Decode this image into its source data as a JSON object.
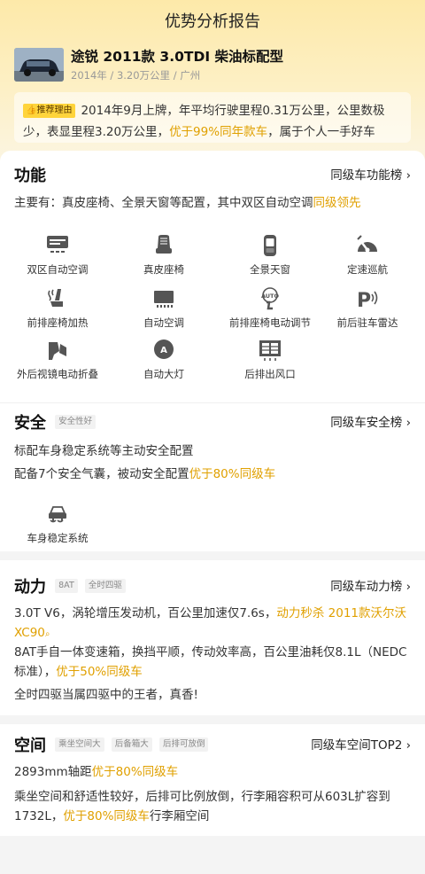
{
  "header": {
    "title": "优势分析报告"
  },
  "car": {
    "title": "途锐 2011款 3.0TDI 柴油标配型",
    "meta": "2014年 / 3.20万公里 / 广州"
  },
  "reason": {
    "badge": "推荐理由",
    "text1": "2014年9月上牌，年平均行驶里程0.31万公里，公里数极少，表显里程3.20万公里，",
    "highlight": "优于99%同年款车",
    "text2": "，属于个人一手好车"
  },
  "features": {
    "title": "功能",
    "more": "同级车功能榜 ›",
    "summary1": "主要有：真皮座椅、全景天窗等配置，其中双区自动空调",
    "summary_hl": "同级领先",
    "items": [
      {
        "label": "双区自动空调",
        "icon": "ac-dual-zone-icon"
      },
      {
        "label": "真皮座椅",
        "icon": "leather-seat-icon"
      },
      {
        "label": "全景天窗",
        "icon": "sunroof-icon"
      },
      {
        "label": "定速巡航",
        "icon": "cruise-control-icon"
      },
      {
        "label": "前排座椅加热",
        "icon": "seat-heating-icon"
      },
      {
        "label": "自动空调",
        "icon": "auto-ac-icon"
      },
      {
        "label": "前排座椅电动调节",
        "icon": "auto-seat-adjust-icon"
      },
      {
        "label": "前后驻车雷达",
        "icon": "parking-radar-icon"
      },
      {
        "label": "外后视镜电动折叠",
        "icon": "mirror-fold-icon"
      },
      {
        "label": "自动大灯",
        "icon": "auto-headlight-icon"
      },
      {
        "label": "后排出风口",
        "icon": "rear-vent-icon"
      }
    ]
  },
  "safety": {
    "title": "安全",
    "tag": "安全性好",
    "more": "同级车安全榜 ›",
    "line1": "标配车身稳定系统等主动安全配置",
    "line2": "配备7个安全气囊，被动安全配置",
    "line2_hl": "优于80%同级车",
    "items": [
      {
        "label": "车身稳定系统",
        "icon": "stability-control-icon"
      }
    ]
  },
  "power": {
    "title": "动力",
    "tags": [
      "8AT",
      "全时四驱"
    ],
    "more": "同级车动力榜 ›",
    "p1": "3.0T V6，涡轮增压发动机，百公里加速仅7.6s，",
    "p1_hl": "动力秒杀 2011款沃尔沃XC90",
    "p2": "8AT手自一体变速箱，换挡平顺，传动效率高，百公里油耗仅8.1L（NEDC标准），",
    "p2_hl": "优于50%同级车",
    "p3": "全时四驱当属四驱中的王者，真香!"
  },
  "space": {
    "title": "空间",
    "tags": [
      "乘坐空间大",
      "后备箱大",
      "后排可放倒"
    ],
    "more": "同级车空间TOP2 ›",
    "p1": "2893mm轴距",
    "p1_hl": "优于80%同级车",
    "p2": "乘坐空间和舒适性较好，后排可比例放倒，行李厢容积可从603L扩容到1732L，",
    "p2_hl": "优于80%同级车",
    "p2_tail": "行李厢空间"
  }
}
